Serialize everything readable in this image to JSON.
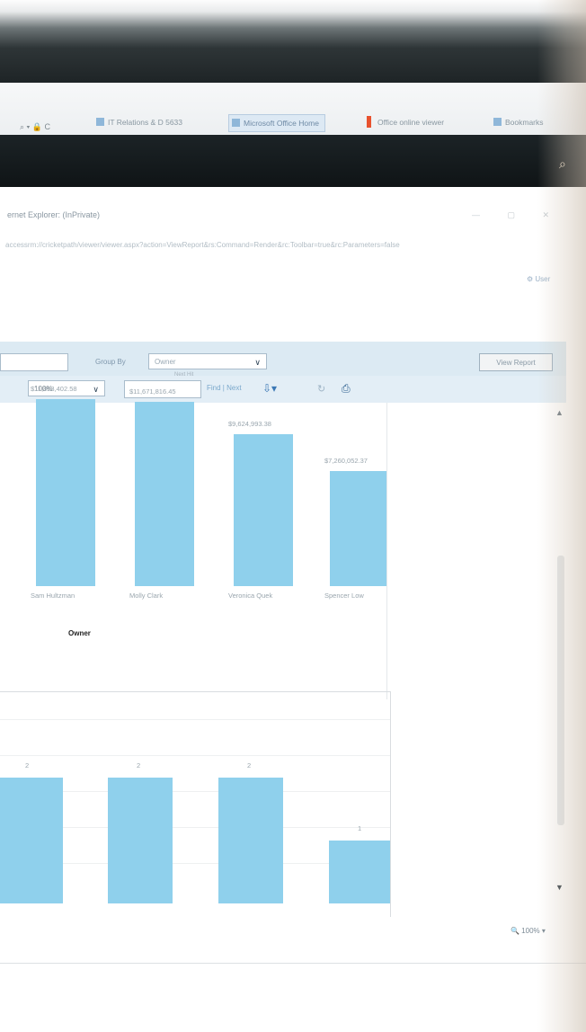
{
  "browser": {
    "nav_controls": "⌕ ▾ 🔒 C",
    "tabs": [
      {
        "label": "IT Relations & D 5633",
        "state": "normal"
      },
      {
        "label": "Microsoft Office Home",
        "state": "active"
      },
      {
        "label": "Office online viewer",
        "state": "normal"
      },
      {
        "label": "Bookmarks",
        "state": "normal"
      }
    ]
  },
  "window": {
    "title": "ernet Explorer: (InPrivate)",
    "controls": "— ▢ ✕",
    "url": "accessrm://cricketpath/viewer/viewer.aspx?action=ViewReport&rs:Command=Render&rc:Toolbar=true&rc:Parameters=false",
    "user_link": "⚙ User"
  },
  "filterbar": {
    "groupby_label": "Group By",
    "groupby_value": "Owner",
    "view_report_label": "View Report"
  },
  "toolbar": {
    "zoom_value": "100%",
    "find_top_label": "Next Hit",
    "find_next_label": "Find | Next",
    "export_icon": "export-icon",
    "refresh_icon": "refresh-icon",
    "print_icon": "print-icon"
  },
  "chart_data": [
    {
      "type": "bar",
      "categories": [
        "Sam Hultzman",
        "Molly Clark",
        "Veronica Quek",
        "Spencer Low"
      ],
      "values": [
        11853402.58,
        11671816.45,
        9624993.38,
        7260052.37
      ],
      "data_labels": [
        "$11,853,402.58",
        "$11,671,816.45",
        "$9,624,993.38",
        "$7,260,052.37"
      ],
      "xlabel": "Owner",
      "ylim": [
        0,
        14000000
      ]
    },
    {
      "type": "bar",
      "categories": [
        "",
        "",
        "",
        ""
      ],
      "values": [
        2,
        2,
        2,
        1
      ],
      "data_labels": [
        "2",
        "2",
        "2",
        "1"
      ],
      "ylim": [
        0,
        3
      ]
    }
  ],
  "status": {
    "zoom_label": "🔍 100% ▾"
  },
  "scrollbar": {
    "up_icon": "▲",
    "down_icon": "▼"
  }
}
